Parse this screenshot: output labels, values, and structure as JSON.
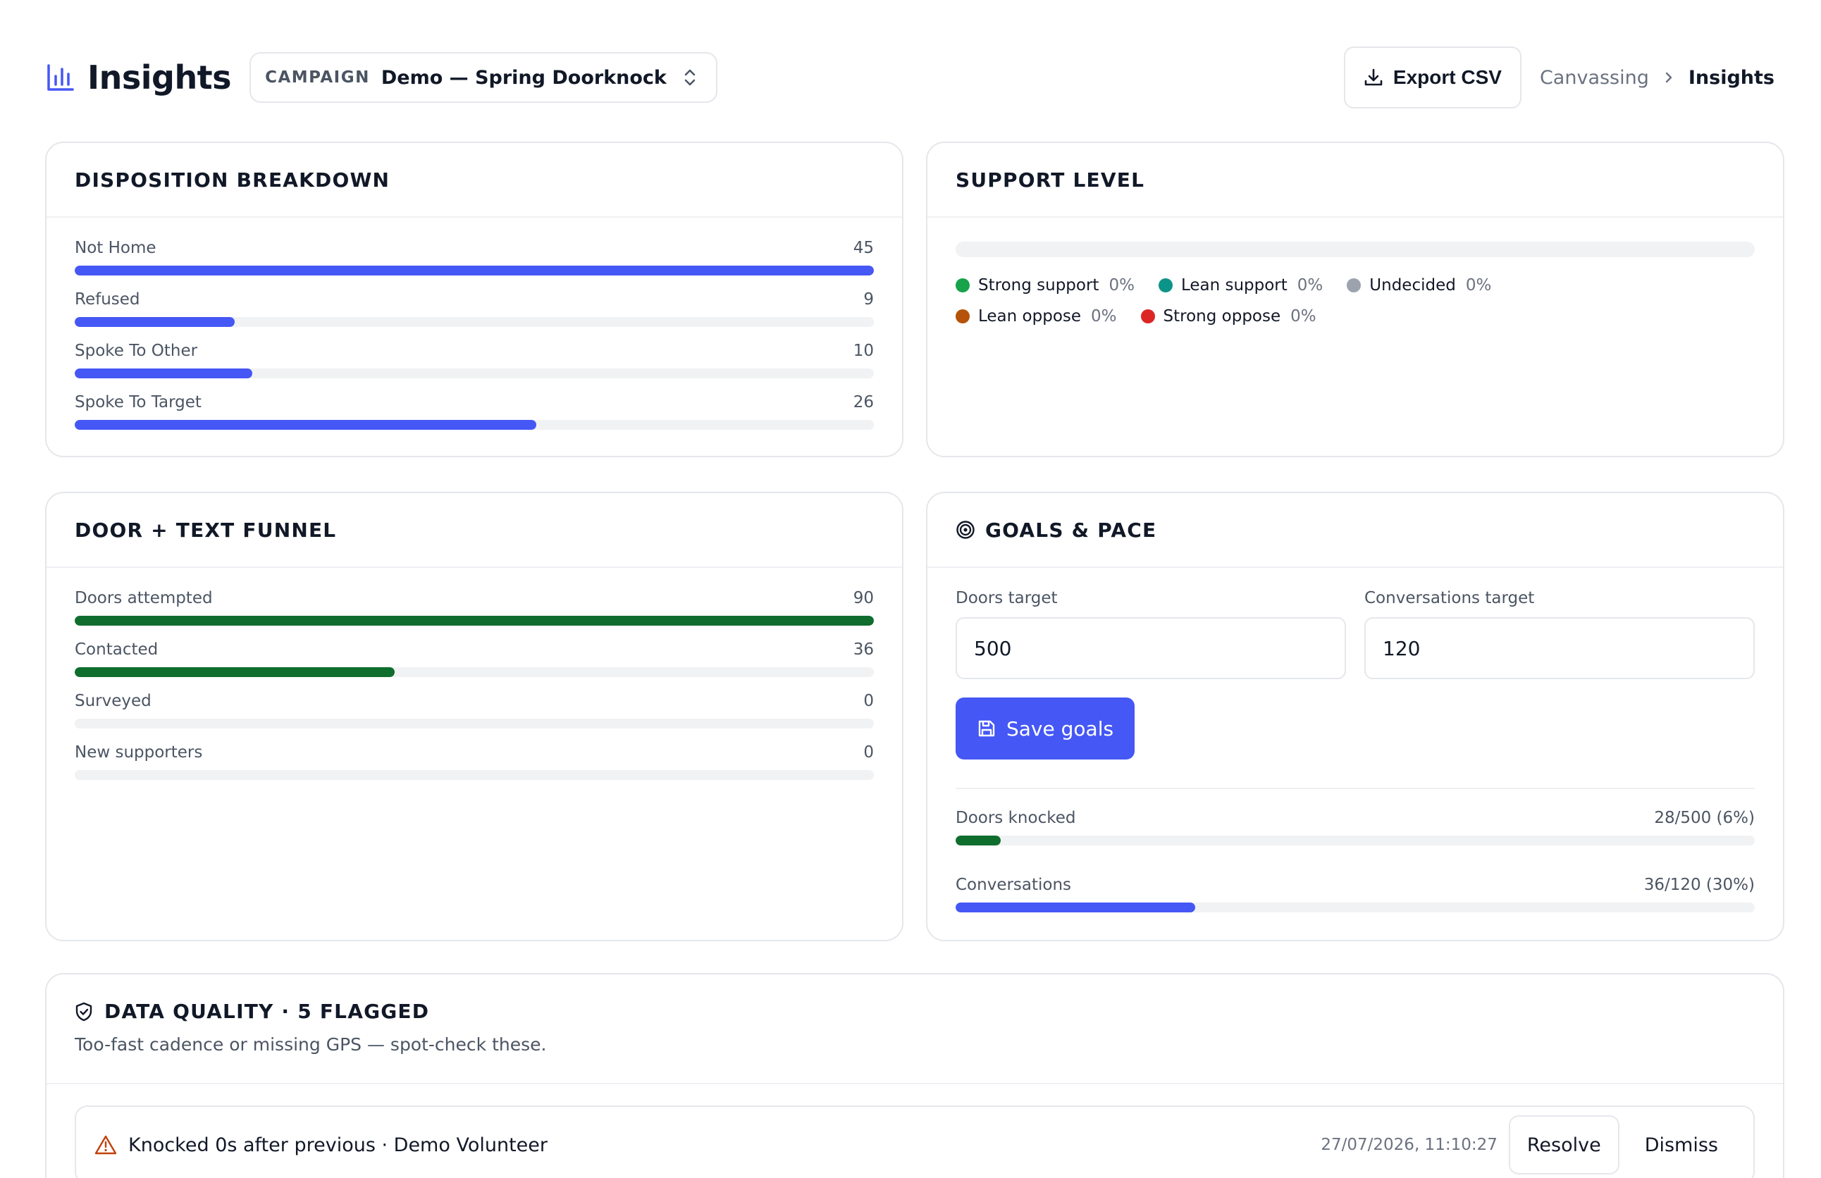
{
  "header": {
    "title": "Insights",
    "icon": "bar-chart-icon",
    "campaign_label": "CAMPAIGN",
    "campaign_value": "Demo — Spring Doorknock",
    "export_label": "Export CSV",
    "breadcrumb": {
      "parent": "Canvassing",
      "current": "Insights"
    }
  },
  "colors": {
    "accent_blue": "#4557f5",
    "accent_green": "#0f6e2e"
  },
  "disposition": {
    "title": "DISPOSITION BREAKDOWN",
    "max": 45,
    "items": [
      {
        "label": "Not Home",
        "value": 45
      },
      {
        "label": "Refused",
        "value": 9
      },
      {
        "label": "Spoke To Other",
        "value": 10
      },
      {
        "label": "Spoke To Target",
        "value": 26
      }
    ]
  },
  "support": {
    "title": "SUPPORT LEVEL",
    "legend": [
      {
        "label": "Strong support",
        "pct": "0%",
        "color": "#16a34a"
      },
      {
        "label": "Lean support",
        "pct": "0%",
        "color": "#0d9488"
      },
      {
        "label": "Undecided",
        "pct": "0%",
        "color": "#9ca3af"
      },
      {
        "label": "Lean oppose",
        "pct": "0%",
        "color": "#b45309"
      },
      {
        "label": "Strong oppose",
        "pct": "0%",
        "color": "#dc2626"
      }
    ]
  },
  "funnel": {
    "title": "DOOR + TEXT FUNNEL",
    "max": 90,
    "items": [
      {
        "label": "Doors attempted",
        "value": 90
      },
      {
        "label": "Contacted",
        "value": 36
      },
      {
        "label": "Surveyed",
        "value": 0
      },
      {
        "label": "New supporters",
        "value": 0
      }
    ]
  },
  "goals": {
    "title": "GOALS & PACE",
    "icon": "target-icon",
    "doors_target_label": "Doors target",
    "doors_target_value": "500",
    "conversations_target_label": "Conversations target",
    "conversations_target_value": "120",
    "save_label": "Save goals",
    "pace": [
      {
        "label": "Doors knocked",
        "display": "28/500 (6%)",
        "fraction": 0.056,
        "color": "green"
      },
      {
        "label": "Conversations",
        "display": "36/120 (30%)",
        "fraction": 0.3,
        "color": "blue"
      }
    ]
  },
  "quality": {
    "title": "DATA QUALITY · 5 FLAGGED",
    "icon": "shield-check-icon",
    "subtitle": "Too-fast cadence or missing GPS — spot-check these.",
    "flags": [
      {
        "text": "Knocked 0s after previous · Demo Volunteer",
        "time": "27/07/2026, 11:10:27",
        "resolve": "Resolve",
        "dismiss": "Dismiss"
      }
    ]
  }
}
